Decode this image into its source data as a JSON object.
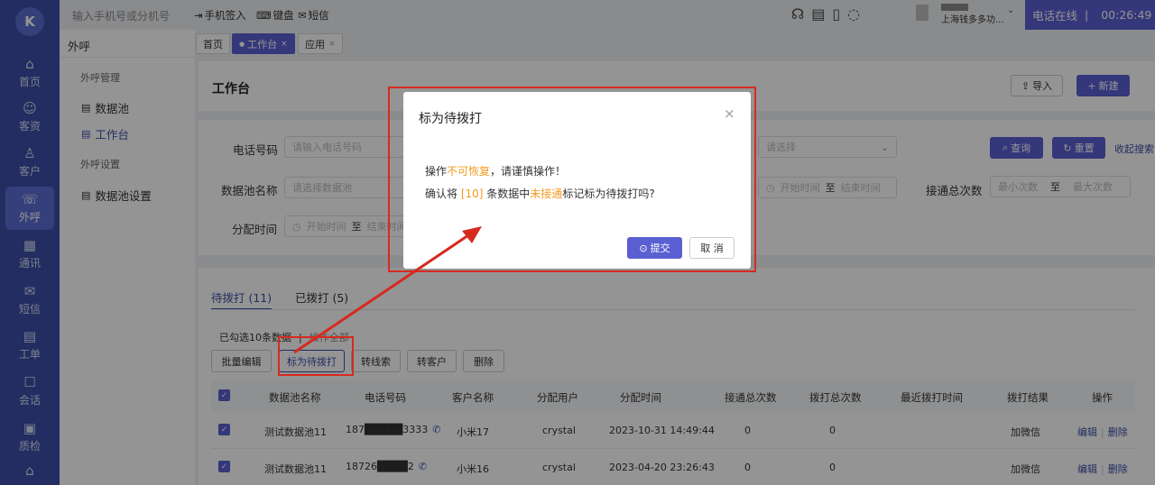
{
  "nav": {
    "logo": "K",
    "items": [
      {
        "label": "首页",
        "icon": "⌂"
      },
      {
        "label": "客资",
        "icon": "☺"
      },
      {
        "label": "客户",
        "icon": "♙"
      },
      {
        "label": "外呼",
        "icon": "☏"
      },
      {
        "label": "通讯",
        "icon": "▦"
      },
      {
        "label": "短信",
        "icon": "✉"
      },
      {
        "label": "工单",
        "icon": "▤"
      },
      {
        "label": "会话",
        "icon": "☐"
      },
      {
        "label": "质检",
        "icon": "▣"
      },
      {
        "label": "",
        "icon": "⌂"
      }
    ]
  },
  "topbar": {
    "search_placeholder": "输入手机号或分机号",
    "phone_checkin": "手机签入",
    "keyboard": "键盘",
    "sms": "短信",
    "company": "上海钱多多功...",
    "status": "电话在线",
    "timer": "00:26:49"
  },
  "subside": {
    "title": "外呼",
    "group1": "外呼管理",
    "item_pool": "数据池",
    "item_workbench": "工作台",
    "group2": "外呼设置",
    "item_pool_settings": "数据池设置"
  },
  "tabs": {
    "home": "首页",
    "workbench": "工作台",
    "apps": "应用"
  },
  "header": {
    "title": "工作台",
    "import": "导入",
    "new": "新建"
  },
  "filters": {
    "phone_label": "电话号码",
    "phone_placeholder": "请输入电话号码",
    "pool_label": "数据池名称",
    "pool_placeholder": "请选择数据池",
    "assign_label": "分配时间",
    "start": "开始时间",
    "to": "至",
    "end": "结束时间",
    "select_placeholder": "请选择",
    "connect_label": "接通总次数",
    "min": "最小次数",
    "max": "最大次数",
    "query": "查询",
    "reset": "重置",
    "collapse": "收起搜索"
  },
  "list": {
    "tab_pending": "待拨打 (11)",
    "tab_dialed": "已拨打 (5)",
    "selected": "已勾选10条数据",
    "sep": "|",
    "op_hint": "操作全部",
    "btn_batch_edit": "批量编辑",
    "btn_mark": "标为待拨打",
    "btn_to_lead": "转线索",
    "btn_to_customer": "转客户",
    "btn_delete": "删除",
    "columns": [
      "数据池名称",
      "电话号码",
      "客户名称",
      "分配用户",
      "分配时间",
      "接通总次数",
      "拨打总次数",
      "最近拨打时间",
      "拨打结果",
      "操作"
    ],
    "rows": [
      {
        "pool": "测试数据池11",
        "phone": "187█████3333",
        "name": "小米17",
        "user": "crystal",
        "time": "2023-10-31 14:49:44",
        "connected": "0",
        "dialed": "0",
        "last": "",
        "result": "加微信",
        "edit": "编辑",
        "sep": "|",
        "del": "删除"
      },
      {
        "pool": "测试数据池11",
        "phone": "18726████2",
        "name": "小米16",
        "user": "crystal",
        "time": "2023-04-20 23:26:43",
        "connected": "0",
        "dialed": "0",
        "last": "",
        "result": "加微信",
        "edit": "编辑",
        "sep": "|",
        "del": "删除"
      }
    ]
  },
  "dialog": {
    "title": "标为待拨打",
    "line1_a": "操作",
    "line1_b": "不可恢复",
    "line1_c": "，请谨慎操作！",
    "line2_a": "确认将 ",
    "line2_count": "[10]",
    "line2_b": " 条数据中",
    "line2_status": "未接通",
    "line2_c": "标记标为待拨打吗?",
    "submit": "提交",
    "cancel": "取 消"
  },
  "colors": {
    "primary": "#5a5fd2",
    "nav": "#3d4ea8",
    "highlight": "#f39a1e",
    "annotation": "#d62a1f"
  }
}
